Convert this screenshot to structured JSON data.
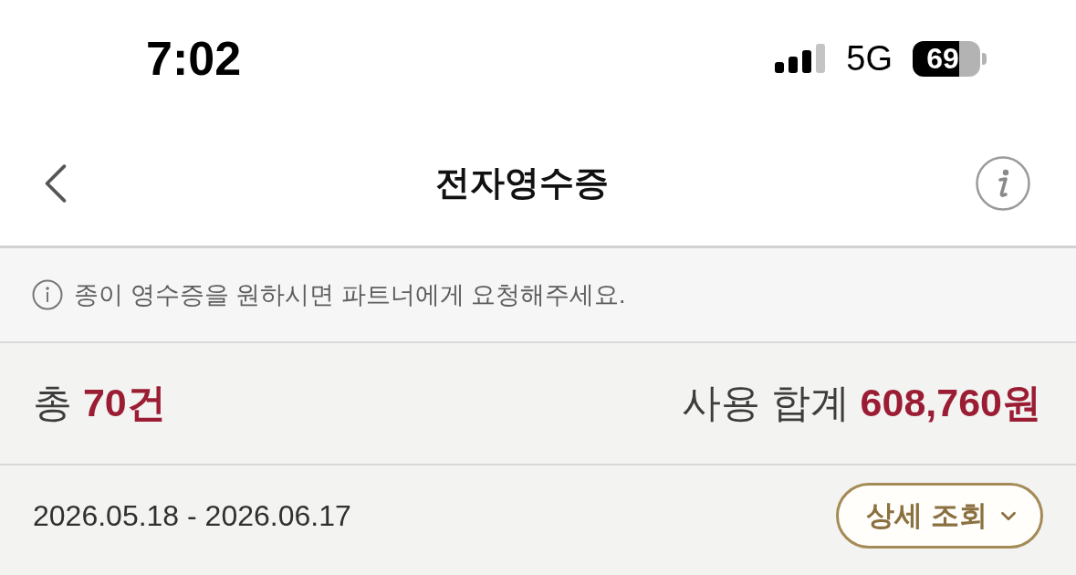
{
  "status_bar": {
    "time": "7:02",
    "network": "5G",
    "battery": "69"
  },
  "header": {
    "title": "전자영수증"
  },
  "notice": {
    "text": "종이 영수증을 원하시면 파트너에게 요청해주세요."
  },
  "summary": {
    "count": "총 **70건**",
    "total": "사용 합계 **608,760원**"
  },
  "period": {
    "date_range": "2026.05.18 - 2026.06.17",
    "detail_button": "상세 조회"
  }
}
